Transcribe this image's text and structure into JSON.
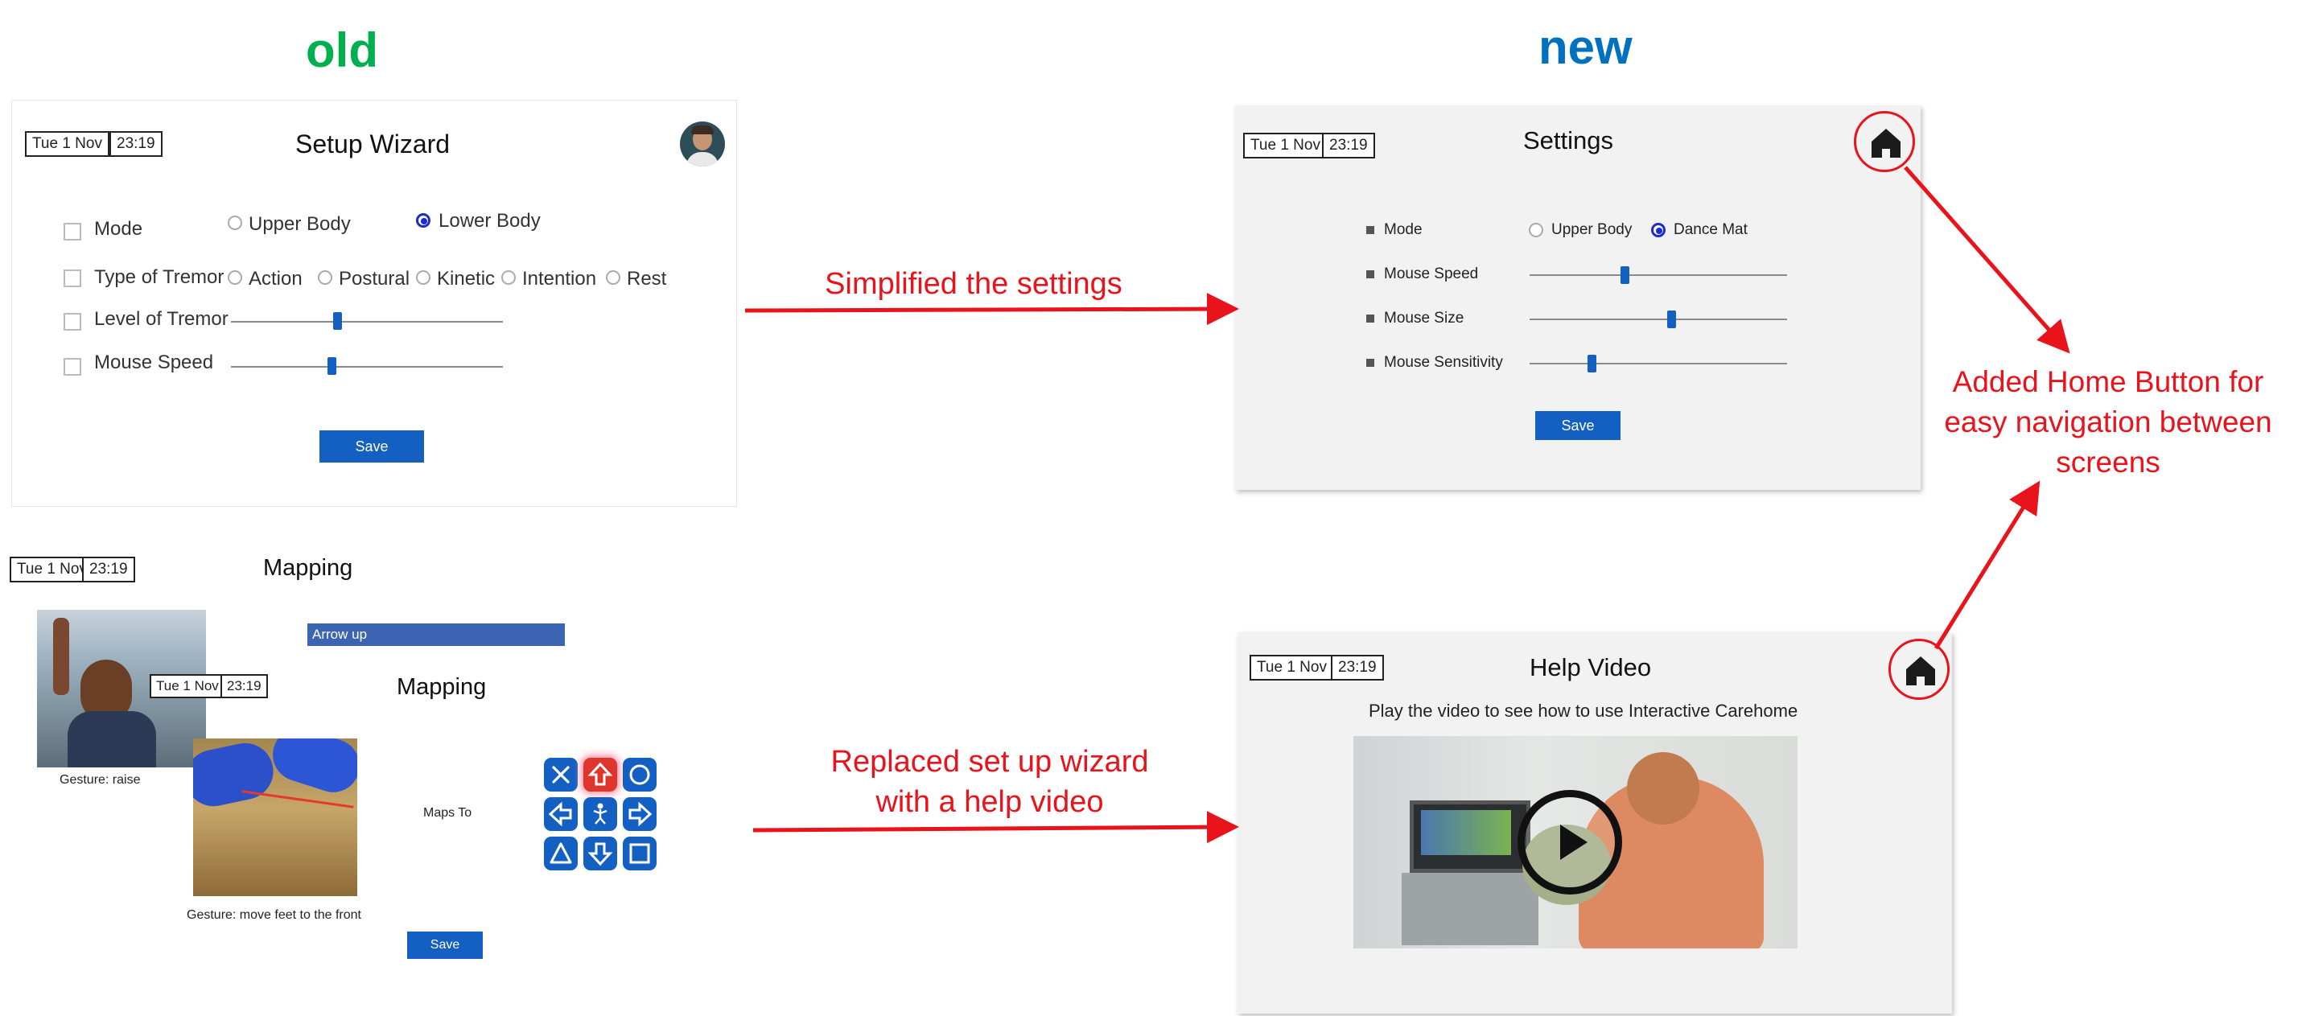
{
  "headers": {
    "old": "old",
    "new": "new"
  },
  "colors": {
    "old_header": "#00b04f",
    "new_header": "#0070c0",
    "annotation": "#e8131b",
    "accent": "#1360c2"
  },
  "old_setup": {
    "date": "Tue 1 Nov",
    "time": "23:19",
    "title": "Setup Wizard",
    "mode_label": "Mode",
    "mode_upper": "Upper Body",
    "mode_lower": "Lower Body",
    "tremor_type_label": "Type of Tremor",
    "tremor_options": [
      "Action",
      "Postural",
      "Kinetic",
      "Intention",
      "Rest"
    ],
    "tremor_level_label": "Level of Tremor",
    "tremor_level_value": 0.39,
    "mouse_speed_label": "Mouse Speed",
    "mouse_speed_value": 0.37,
    "save": "Save"
  },
  "old_mapping_1": {
    "date": "Tue 1 Nov",
    "time": "23:19",
    "title": "Mapping",
    "selection": "Arrow up",
    "gesture": "Gesture: raise"
  },
  "old_mapping_2": {
    "date": "Tue 1 Nov",
    "time": "23:19",
    "title": "Mapping",
    "maps_to": "Maps To",
    "gesture": "Gesture: move feet to the front",
    "save": "Save"
  },
  "new_settings": {
    "date": "Tue 1 Nov",
    "time": "23:19",
    "title": "Settings",
    "mode_label": "Mode",
    "mode_upper": "Upper Body",
    "mode_dance": "Dance Mat",
    "mouse_speed_label": "Mouse Speed",
    "mouse_speed_value": 0.37,
    "mouse_size_label": "Mouse Size",
    "mouse_size_value": 0.55,
    "mouse_sensitivity_label": "Mouse Sensitivity",
    "mouse_sensitivity_value": 0.24,
    "save": "Save"
  },
  "new_help": {
    "date": "Tue 1 Nov",
    "time": "23:19",
    "title": "Help Video",
    "subtitle": "Play the video to see how to use Interactive Carehome"
  },
  "annotations": {
    "simplified": "Simplified the settings",
    "home_l1": "Added Home Button for",
    "home_l2": "easy navigation between",
    "home_l3": "screens",
    "replaced_l1": "Replaced set up wizard",
    "replaced_l2": "with a help video"
  },
  "icons": [
    "home-icon",
    "play-icon",
    "arrow-up-icon",
    "arrow-down-icon",
    "arrow-left-icon",
    "arrow-right-icon",
    "cross-icon",
    "circle-icon",
    "triangle-icon",
    "square-icon",
    "figure-icon"
  ]
}
